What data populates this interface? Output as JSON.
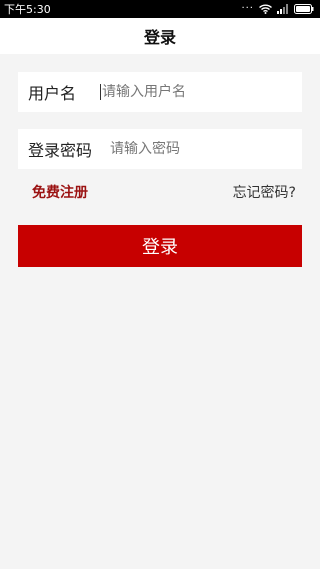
{
  "status_bar": {
    "time": "下午5:30",
    "icons": [
      "wifi-icon",
      "signal-icon",
      "battery-icon"
    ]
  },
  "header": {
    "title": "登录"
  },
  "form": {
    "username": {
      "label": "用户名",
      "placeholder": "请输入用户名",
      "value": ""
    },
    "password": {
      "label": "登录密码",
      "placeholder": "请输入密码",
      "value": ""
    },
    "register_link": "免费注册",
    "forgot_link": "忘记密码?",
    "submit_label": "登录"
  },
  "colors": {
    "accent": "#c70000",
    "register_link": "#9b1212",
    "background": "#f4f4f4"
  }
}
